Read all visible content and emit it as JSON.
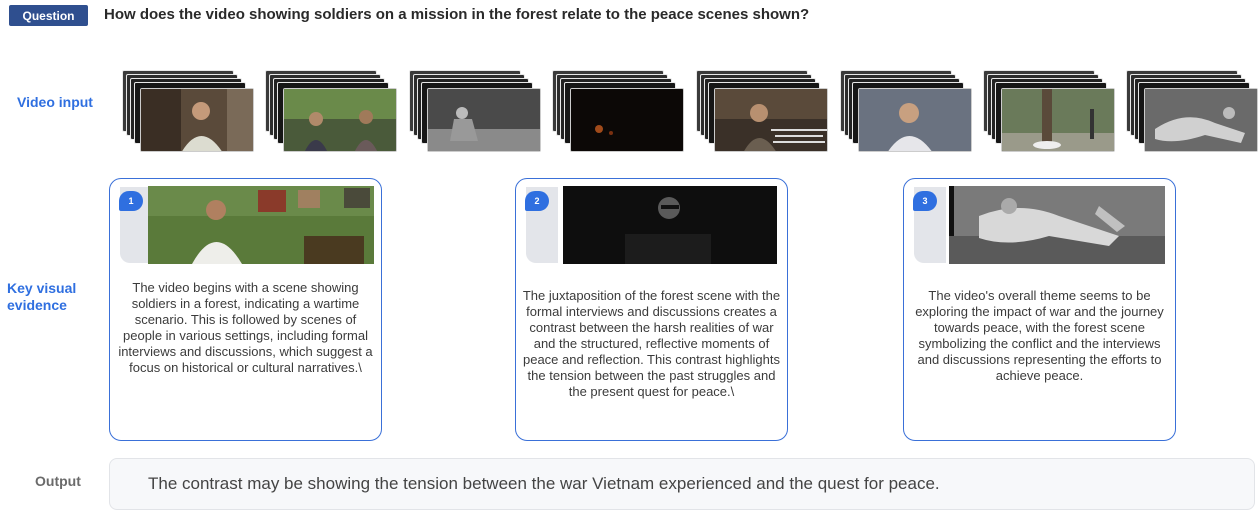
{
  "question": {
    "badge": "Question",
    "text": "How does the video showing soldiers on a mission in the forest relate to the peace scenes shown?"
  },
  "labels": {
    "video_input": "Video input",
    "key_visual_evidence": "Key visual evidence",
    "output": "Output"
  },
  "video_frames": [
    {
      "scene": "elderly man in white shirt seated indoors"
    },
    {
      "scene": "two people seated on couch with plants"
    },
    {
      "scene": "man in black and white crouching"
    },
    {
      "scene": "dark night scene with fire"
    },
    {
      "scene": "elderly man interview with caption text"
    },
    {
      "scene": "smiling elderly man in white shirt"
    },
    {
      "scene": "outdoor street with trees"
    },
    {
      "scene": "black and white soldier lying on ground"
    }
  ],
  "evidence": [
    {
      "number": "1",
      "text": "The video begins with a scene showing soldiers in a forest, indicating a wartime scenario. This is followed by scenes of people in various settings, including formal interviews and discussions, which suggest a focus on historical or cultural narratives.\\"
    },
    {
      "number": "2",
      "text": "The juxtaposition of the forest scene with the formal interviews and discussions creates a contrast between the harsh realities of war and the structured, reflective moments of peace and reflection. This contrast highlights the tension between the past struggles and the present quest for peace.\\"
    },
    {
      "number": "3",
      "text": "The video's overall theme seems to be exploring the impact of war and the journey towards peace, with the forest scene symbolizing the conflict and the interviews and discussions representing the efforts to achieve peace."
    }
  ],
  "output": {
    "text": "The contrast may be showing the tension between the war Vietnam experienced and the quest for peace."
  }
}
